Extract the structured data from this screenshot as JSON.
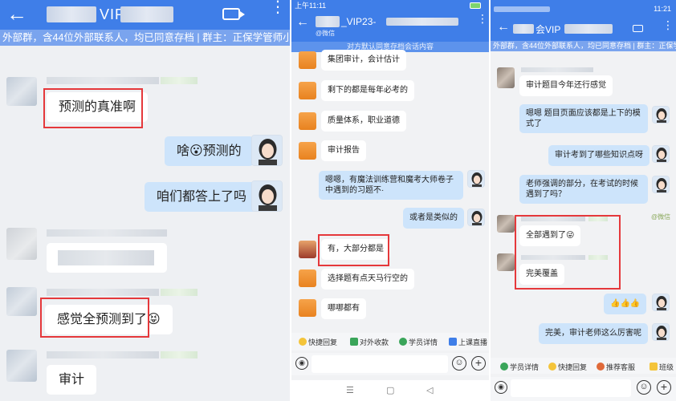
{
  "panel1": {
    "title": "VIP",
    "subtitle": "外部群，含44位外部联系人，均已同意存档 | 群主：正保学管师小可老师",
    "messages": [
      {
        "text": "预测的真准啊"
      },
      {
        "text": "啥😮预测的"
      },
      {
        "text": "咱们都答上了吗"
      },
      {
        "text": "感觉全预测到了😝"
      },
      {
        "text": "审计"
      }
    ]
  },
  "panel2": {
    "status_time": "上午11:11",
    "title": "_VIP23-",
    "wechat_tag": "@微信",
    "agree_bar": "对方默认同意存档会话内容",
    "messages": [
      {
        "text": "集团审计，会计估计"
      },
      {
        "text": "剩下的都是每年必考的"
      },
      {
        "text": "质量体系，职业道德"
      },
      {
        "text": "审计报告"
      },
      {
        "text": "嗯嗯，有魔法训练营和魔考大师卷子中遇到的习题不·"
      },
      {
        "text": "或者是类似的"
      },
      {
        "text": "有，大部分都是"
      },
      {
        "text": "选择题有点天马行空的"
      },
      {
        "text": "哪哪都有"
      }
    ],
    "toolbar": [
      "快捷回复",
      "对外收款",
      "学员详情",
      "上课直播"
    ],
    "nav": [
      "☰",
      "▢",
      "◁"
    ]
  },
  "panel3": {
    "status_time": "11:21",
    "title": "会VIP",
    "subtitle": "外部群，含44位外部联系人，均已同意存档 | 群主：正保学管师小可老",
    "wechat_tag": "@微信",
    "messages": [
      {
        "text": "审计题目今年还行感觉"
      },
      {
        "text": "嗯嗯  题目页面应该都是上下的模式了"
      },
      {
        "text": "审计考到了哪些知识点呀"
      },
      {
        "text": "老师强调的部分，在考试的时候遇到了吗？"
      },
      {
        "text": "全部遇到了😜"
      },
      {
        "text": "完美覆盖"
      },
      {
        "text": "👍👍👍"
      },
      {
        "text": "完美，审计老师这么厉害呢"
      }
    ],
    "toolbar": [
      "学员详情",
      "快捷回复",
      "推荐客服",
      "班级"
    ]
  },
  "colors": {
    "header": "#3f7ee8",
    "subheader": "#7aa4ee",
    "my_bubble": "#cde4fb",
    "highlight": "#e5383b"
  }
}
